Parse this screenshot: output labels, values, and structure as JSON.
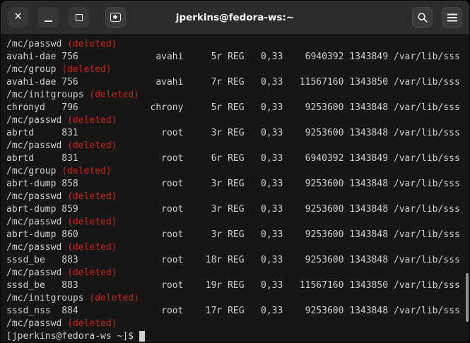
{
  "window": {
    "title": "jperkins@fedora-ws:~"
  },
  "colors": {
    "titlebar_bg": "#2c2c2c",
    "terminal_bg": "#161616",
    "terminal_fg": "#d0cfcc",
    "deleted_red": "#cc241d"
  },
  "icons": {
    "close": "×",
    "minimize": "bar",
    "maximize": "square",
    "new_tab": "plus-square",
    "search": "magnifier",
    "menu": "hamburger"
  },
  "terminal": {
    "lines": [
      {
        "text": "/mc/passwd ",
        "deleted": "(deleted)"
      },
      {
        "text": "avahi-dae 756              avahi     5r REG   0,33    6940392 1343849 /var/lib/sss"
      },
      {
        "text": "/mc/group ",
        "deleted": "(deleted)"
      },
      {
        "text": "avahi-dae 756              avahi     7r REG   0,33   11567160 1343850 /var/lib/sss"
      },
      {
        "text": "/mc/initgroups ",
        "deleted": "(deleted)"
      },
      {
        "text": "chronyd   796             chrony     5r REG   0,33    9253600 1343848 /var/lib/sss"
      },
      {
        "text": "/mc/passwd ",
        "deleted": "(deleted)"
      },
      {
        "text": "abrtd     831               root     3r REG   0,33    9253600 1343848 /var/lib/sss"
      },
      {
        "text": "/mc/passwd ",
        "deleted": "(deleted)"
      },
      {
        "text": "abrtd     831               root     6r REG   0,33    6940392 1343849 /var/lib/sss"
      },
      {
        "text": "/mc/group ",
        "deleted": "(deleted)"
      },
      {
        "text": "abrt-dump 858               root     3r REG   0,33    9253600 1343848 /var/lib/sss"
      },
      {
        "text": "/mc/passwd ",
        "deleted": "(deleted)"
      },
      {
        "text": "abrt-dump 859               root     3r REG   0,33    9253600 1343848 /var/lib/sss"
      },
      {
        "text": "/mc/passwd ",
        "deleted": "(deleted)"
      },
      {
        "text": "abrt-dump 860               root     3r REG   0,33    9253600 1343848 /var/lib/sss"
      },
      {
        "text": "/mc/passwd ",
        "deleted": "(deleted)"
      },
      {
        "text": "sssd_be   883               root    18r REG   0,33    9253600 1343848 /var/lib/sss"
      },
      {
        "text": "/mc/passwd ",
        "deleted": "(deleted)"
      },
      {
        "text": "sssd_be   883               root    19r REG   0,33   11567160 1343850 /var/lib/sss"
      },
      {
        "text": "/mc/initgroups ",
        "deleted": "(deleted)"
      },
      {
        "text": "sssd_nss  884               root    17r REG   0,33    9253600 1343848 /var/lib/sss"
      },
      {
        "text": "/mc/passwd ",
        "deleted": "(deleted)"
      }
    ],
    "prompt": "[jperkins@fedora-ws ~]$ "
  }
}
